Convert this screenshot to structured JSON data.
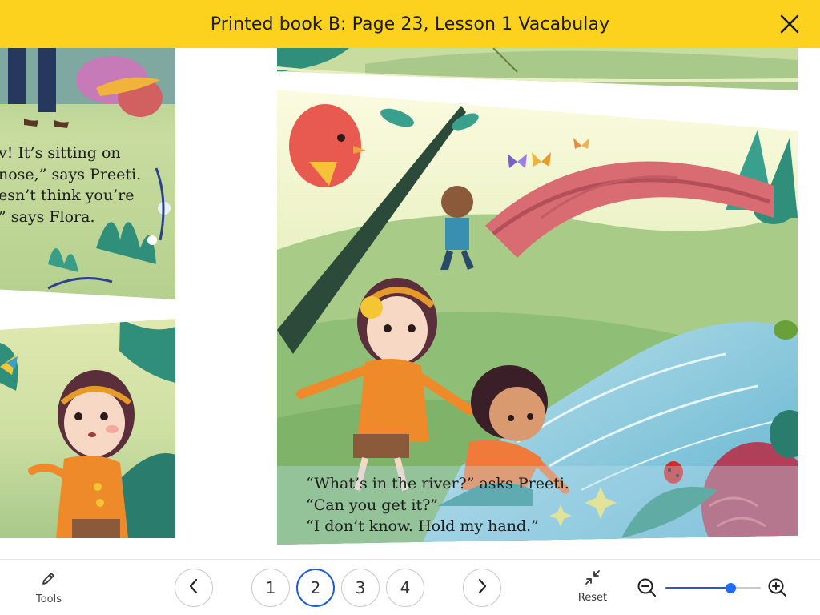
{
  "header": {
    "title": "Printed book B: Page 23, Lesson 1 Vacabulay"
  },
  "book": {
    "left_page_text": [
      "v! It’s sitting on",
      "nose,” says Preeti.",
      "esn’t think you’re",
      "” says Flora."
    ],
    "main_page_text": [
      "“What’s in the river?” asks Preeti.",
      "“Can you get it?”",
      "“I don’t know. Hold my hand.”"
    ]
  },
  "toolbar": {
    "tools_label": "Tools",
    "reset_label": "Reset",
    "pages": [
      "1",
      "2",
      "3",
      "4"
    ],
    "current_page": "2",
    "zoom_level": 0.68
  },
  "colors": {
    "header_bg": "#fdd21f",
    "accent": "#1f5bd6"
  }
}
